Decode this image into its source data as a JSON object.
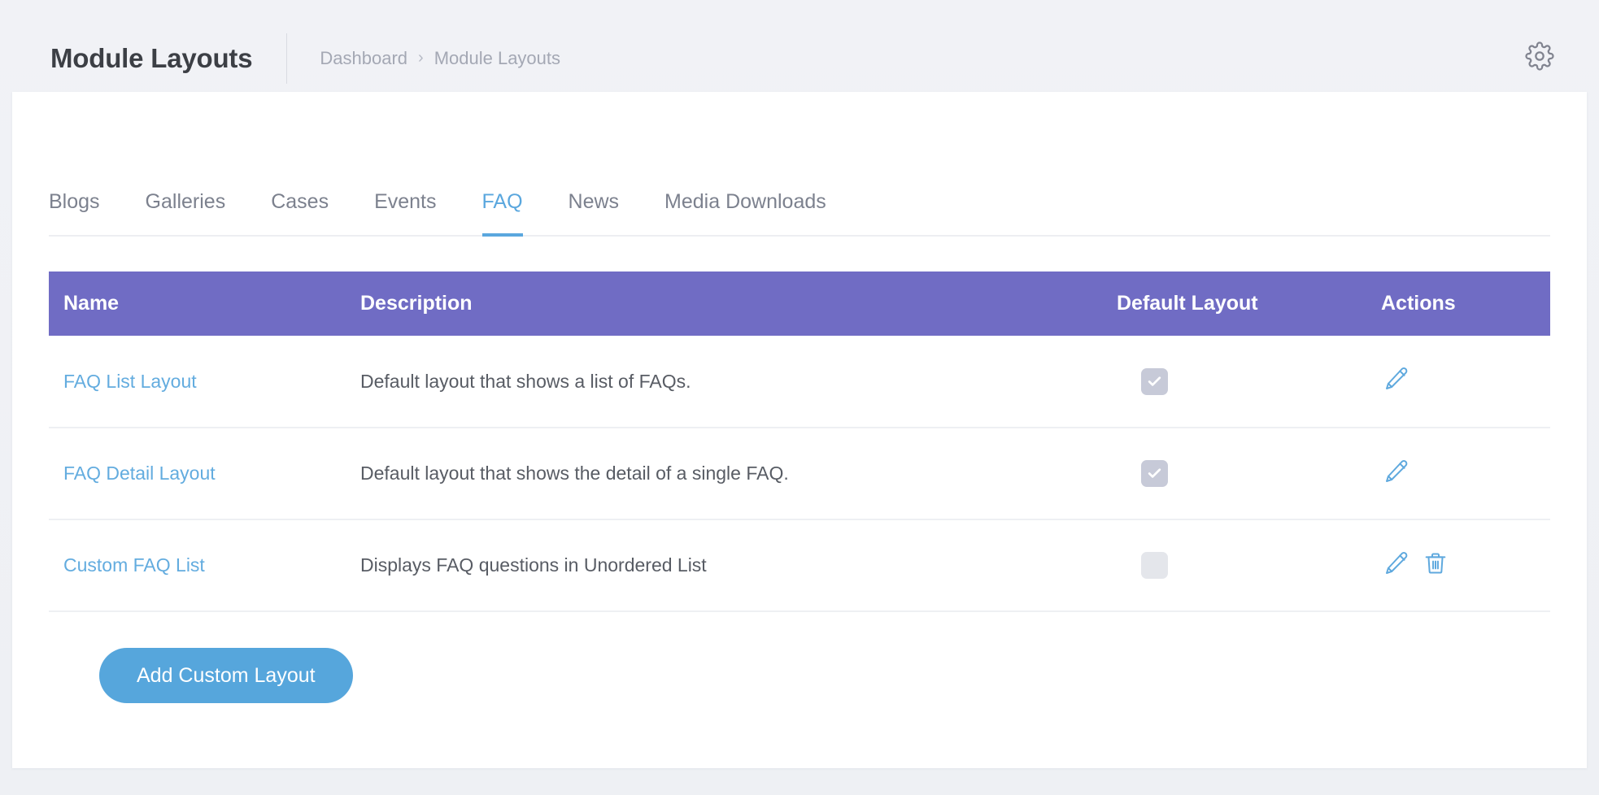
{
  "header": {
    "title": "Module Layouts",
    "breadcrumb": {
      "root": "Dashboard",
      "separator": "›",
      "current": "Module Layouts"
    },
    "settings_icon": "gear-icon"
  },
  "tabs": [
    {
      "label": "Blogs",
      "active": false
    },
    {
      "label": "Galleries",
      "active": false
    },
    {
      "label": "Cases",
      "active": false
    },
    {
      "label": "Events",
      "active": false
    },
    {
      "label": "FAQ",
      "active": true
    },
    {
      "label": "News",
      "active": false
    },
    {
      "label": "Media Downloads",
      "active": false
    }
  ],
  "table": {
    "columns": [
      "Name",
      "Description",
      "Default Layout",
      "Actions"
    ],
    "rows": [
      {
        "name": "FAQ List Layout",
        "description": "Default layout that shows a list of FAQs.",
        "default_layout": true,
        "actions": [
          "edit-icon"
        ]
      },
      {
        "name": "FAQ Detail Layout",
        "description": "Default layout that shows the detail of a single FAQ.",
        "default_layout": true,
        "actions": [
          "edit-icon"
        ]
      },
      {
        "name": "Custom FAQ List",
        "description": "Displays FAQ questions in Unordered List",
        "default_layout": false,
        "actions": [
          "edit-icon",
          "delete-icon"
        ]
      }
    ]
  },
  "footer": {
    "add_button_label": "Add Custom Layout"
  },
  "colors": {
    "page_background": "#f0f1f5",
    "card_background": "#ffffff",
    "table_header": "#706cc4",
    "accent_blue": "#5aa7de",
    "button_blue": "#56a6dc",
    "link_blue": "#63acdf",
    "checkbox_on": "#c7cad8",
    "checkbox_off": "#e4e6eb",
    "text_primary": "#3c3f45",
    "text_secondary": "#5e6268",
    "text_muted": "#a4a8b4"
  }
}
